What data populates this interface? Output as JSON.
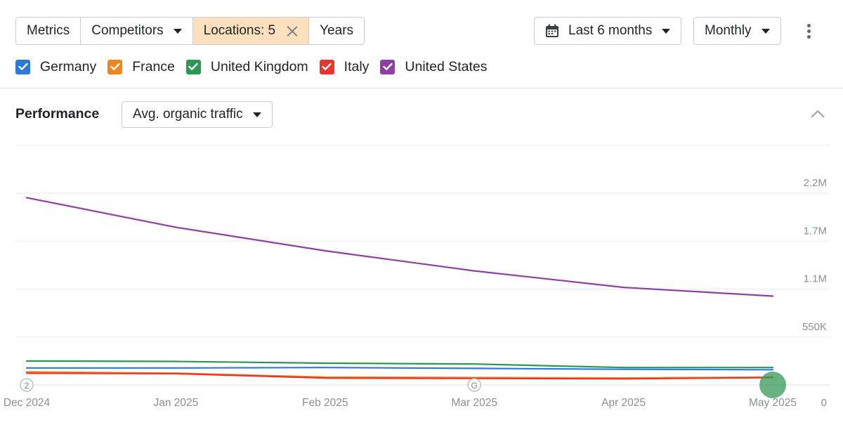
{
  "toolbar": {
    "metrics_label": "Metrics",
    "competitors_label": "Competitors",
    "locations_label": "Locations: 5",
    "years_label": "Years",
    "range_label": "Last 6 months",
    "interval_label": "Monthly"
  },
  "legend": {
    "items": [
      {
        "label": "Germany",
        "color": "#2b7bd6",
        "checked": true
      },
      {
        "label": "France",
        "color": "#f0871e",
        "checked": true
      },
      {
        "label": "United Kingdom",
        "color": "#279a4f",
        "checked": true
      },
      {
        "label": "Italy",
        "color": "#e8352f",
        "checked": true
      },
      {
        "label": "United States",
        "color": "#8e3fa3",
        "checked": true
      }
    ]
  },
  "performance": {
    "title": "Performance",
    "metric_label": "Avg. organic traffic"
  },
  "chart_data": {
    "type": "line",
    "categories": [
      "Dec 2024",
      "Jan 2025",
      "Feb 2025",
      "Mar 2025",
      "Apr 2025",
      "May 2025"
    ],
    "ylim": [
      0,
      2750000
    ],
    "y_ticks": [
      {
        "value": 0,
        "label": "0"
      },
      {
        "value": 550000,
        "label": "550K"
      },
      {
        "value": 1100000,
        "label": "1.1M"
      },
      {
        "value": 1650000,
        "label": "1.7M"
      },
      {
        "value": 2200000,
        "label": "2.2M"
      }
    ],
    "grid": true,
    "y_axis_side": "right",
    "series": [
      {
        "name": "United States",
        "color": "#8e3fa3",
        "values": [
          2150000,
          1810000,
          1540000,
          1310000,
          1120000,
          1020000
        ]
      },
      {
        "name": "United Kingdom",
        "color": "#279a4f",
        "values": [
          275000,
          270000,
          250000,
          240000,
          200000,
          200000
        ]
      },
      {
        "name": "Germany",
        "color": "#2b7bd6",
        "values": [
          195000,
          195000,
          200000,
          190000,
          180000,
          175000
        ]
      },
      {
        "name": "France",
        "color": "#f0871e",
        "values": [
          150000,
          135000,
          90000,
          85000,
          80000,
          90000
        ]
      },
      {
        "name": "Italy",
        "color": "#e8352f",
        "values": [
          135000,
          130000,
          80000,
          75000,
          70000,
          85000
        ]
      }
    ],
    "annotations": [
      {
        "category": "Dec 2024",
        "label": "2"
      },
      {
        "category": "Mar 2025",
        "label": "G"
      }
    ]
  }
}
